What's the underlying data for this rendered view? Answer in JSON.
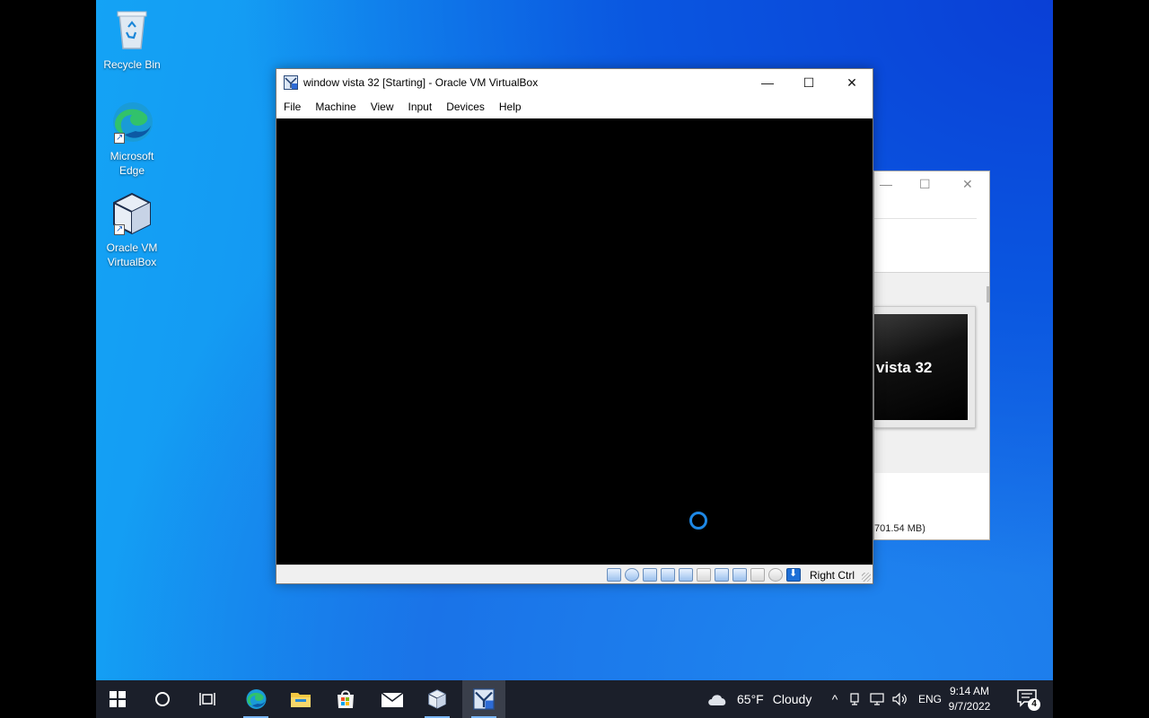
{
  "desktop": {
    "icons": [
      {
        "label_line1": "Recycle Bin",
        "label_line2": ""
      },
      {
        "label_line1": "Microsoft",
        "label_line2": "Edge"
      },
      {
        "label_line1": "Oracle VM",
        "label_line2": "VirtualBox"
      }
    ]
  },
  "vm_window": {
    "title": "window vista 32 [Starting] - Oracle VM VirtualBox",
    "controls": {
      "minimize": "—",
      "maximize": "☐",
      "close": "✕"
    },
    "menu": [
      "File",
      "Machine",
      "View",
      "Input",
      "Devices",
      "Help"
    ],
    "host_key": "Right Ctrl",
    "status_icons": [
      "hard-disk-icon",
      "optical-drive-icon",
      "audio-icon",
      "network-icon",
      "usb-icon",
      "shared-folders-icon",
      "display-icon",
      "video-capture-icon",
      "cpu-icon",
      "mouse-integration-icon",
      "host-key-arrow-icon"
    ]
  },
  "back_window": {
    "controls": {
      "minimize": "—",
      "maximize": "☐",
      "close": "✕"
    },
    "preview_text": "vista 32",
    "size_text": "701.54 MB)"
  },
  "taskbar": {
    "apps": [
      "start-icon",
      "search-icon",
      "task-view-icon",
      "edge-icon",
      "file-explorer-icon",
      "microsoft-store-icon",
      "mail-icon",
      "virtualbox-icon",
      "virtualbox-vm-icon"
    ],
    "weather_temp": "65°F",
    "weather_text": "Cloudy",
    "language": "ENG",
    "time": "9:14 AM",
    "date": "9/7/2022",
    "notification_count": "4"
  },
  "colors": {
    "taskbar": "#1b1f2a",
    "accent": "#1e88e5",
    "desktop": "#1390f0"
  }
}
